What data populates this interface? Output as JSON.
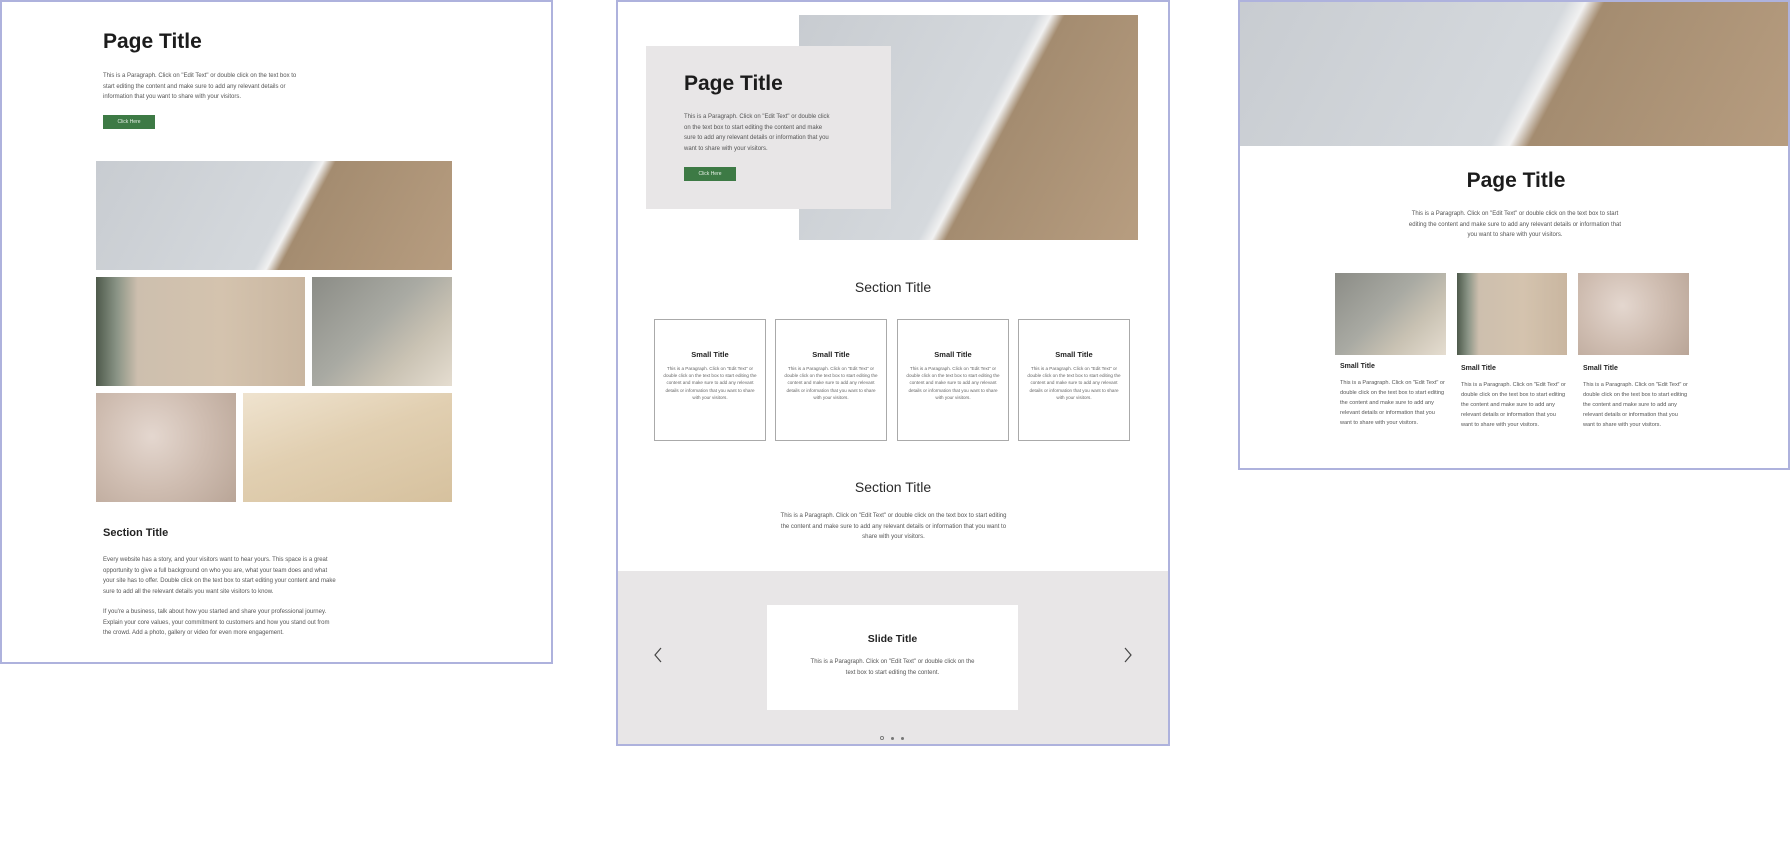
{
  "colors": {
    "accent": "#3d7a45",
    "frame_border": "#aeb2dd",
    "panel_grey": "#e8e6e7"
  },
  "layout1": {
    "page_title": "Page Title",
    "intro": "This is a Paragraph. Click on \"Edit Text\" or double click on the text box to start editing the content and make sure to add any relevant details or information that you want to share with your visitors.",
    "button": "Click Here",
    "section_title": "Section Title",
    "body1": "Every website has a story, and your visitors want to hear yours. This space is a great opportunity to give a full background on who you are, what your team does and what your site has to offer. Double click on the text box to start editing your content and make sure to add all the relevant details you want site visitors to know.",
    "body2": "If you're a business, talk about how you started and share your professional journey. Explain your core values, your commitment to customers and how you stand out from the crowd. Add a photo, gallery or video for even more engagement."
  },
  "layout2": {
    "page_title": "Page Title",
    "intro": "This is a Paragraph. Click on \"Edit Text\" or double click on the text box to start editing the content and make sure to add any relevant details or information that you want to share with your visitors.",
    "button": "Click Here",
    "section_title": "Section Title",
    "cards": [
      {
        "title": "Small Title",
        "text": "This is a Paragraph. Click on \"Edit Text\" or double click on the text box to start editing the content and make sure to add any relevant details or information that you want to share with your visitors."
      },
      {
        "title": "Small Title",
        "text": "This is a Paragraph. Click on \"Edit Text\" or double click on the text box to start editing the content and make sure to add any relevant details or information that you want to share with your visitors."
      },
      {
        "title": "Small Title",
        "text": "This is a Paragraph. Click on \"Edit Text\" or double click on the text box to start editing the content and make sure to add any relevant details or information that you want to share with your visitors."
      },
      {
        "title": "Small Title",
        "text": "This is a Paragraph. Click on \"Edit Text\" or double click on the text box to start editing the content and make sure to add any relevant details or information that you want to share with your visitors."
      }
    ],
    "section2_title": "Section Title",
    "section2_text": "This is a Paragraph. Click on \"Edit Text\" or double click on the text box to start editing the content and make sure to add any relevant details or information that you want to share with your visitors.",
    "slide_title": "Slide Title",
    "slide_text": "This is a Paragraph. Click on \"Edit Text\" or double click on the text box to start editing the content.",
    "prev_icon": "chevron-left-icon",
    "next_icon": "chevron-right-icon"
  },
  "layout3": {
    "page_title": "Page Title",
    "intro": "This is a Paragraph. Click on \"Edit Text\" or double click on the text box to start editing the content and make sure to add any relevant details or information that you want to share with your visitors.",
    "items": [
      {
        "title": "Small Title",
        "text": "This is a Paragraph. Click on \"Edit Text\" or double click on the text box to start editing the content and make sure to add any relevant details or information that you want to share with your visitors."
      },
      {
        "title": "Small Title",
        "text": "This is a Paragraph. Click on \"Edit Text\" or double click on the text box to start editing the content and make sure to add any relevant details or information that you want to share with your visitors."
      },
      {
        "title": "Small Title",
        "text": "This is a Paragraph. Click on \"Edit Text\" or double click on the text box to start editing the content and make sure to add any relevant details or information that you want to share with your visitors."
      }
    ]
  }
}
